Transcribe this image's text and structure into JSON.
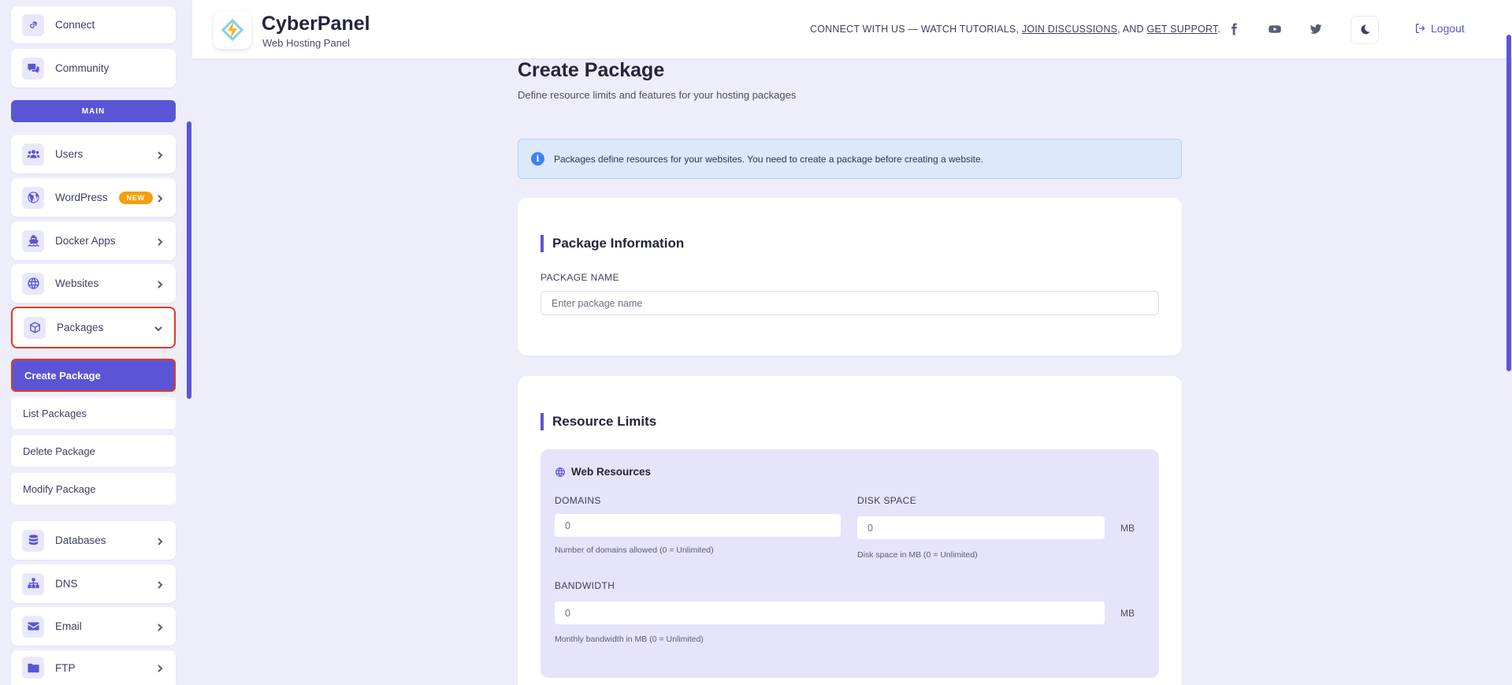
{
  "sidebar": {
    "connect": "Connect",
    "community": "Community",
    "main_header": "MAIN",
    "users": "Users",
    "wordpress": "WordPress",
    "wordpress_badge": "NEW",
    "docker_apps": "Docker Apps",
    "websites": "Websites",
    "packages": "Packages",
    "create_package": "Create Package",
    "list_packages": "List Packages",
    "delete_package": "Delete Package",
    "modify_package": "Modify Package",
    "databases": "Databases",
    "dns": "DNS",
    "email": "Email",
    "ftp": "FTP"
  },
  "header": {
    "brand": "CyberPanel",
    "brand_sub": "Web Hosting Panel",
    "connect_prefix": "CONNECT WITH US — WATCH TUTORIALS, ",
    "join_discussions": "JOIN DISCUSSIONS",
    "connect_mid": ", AND ",
    "get_support": "GET SUPPORT",
    "connect_suffix": ".",
    "logout": "Logout"
  },
  "page": {
    "title": "Create Package",
    "subtitle": "Define resource limits and features for your hosting packages",
    "alert": "Packages define resources for your websites. You need to create a package before creating a website."
  },
  "package_info": {
    "title": "Package Information",
    "name_label": "PACKAGE NAME",
    "name_placeholder": "Enter package name"
  },
  "resource_limits": {
    "title": "Resource Limits",
    "web_resources_title": "Web Resources",
    "domains_label": "DOMAINS",
    "domains_value": "0",
    "domains_help": "Number of domains allowed (0 = Unlimited)",
    "disk_label": "DISK SPACE",
    "disk_value": "0",
    "disk_unit": "MB",
    "disk_help": "Disk space in MB (0 = Unlimited)",
    "bandwidth_label": "BANDWIDTH",
    "bandwidth_value": "0",
    "bandwidth_unit": "MB",
    "bandwidth_help": "Monthly bandwidth in MB (0 = Unlimited)"
  },
  "colors": {
    "accent": "#5b55d6",
    "badge": "#f59e0b",
    "highlight": "#e03a1e",
    "alert_bg": "#dbe9fb"
  }
}
